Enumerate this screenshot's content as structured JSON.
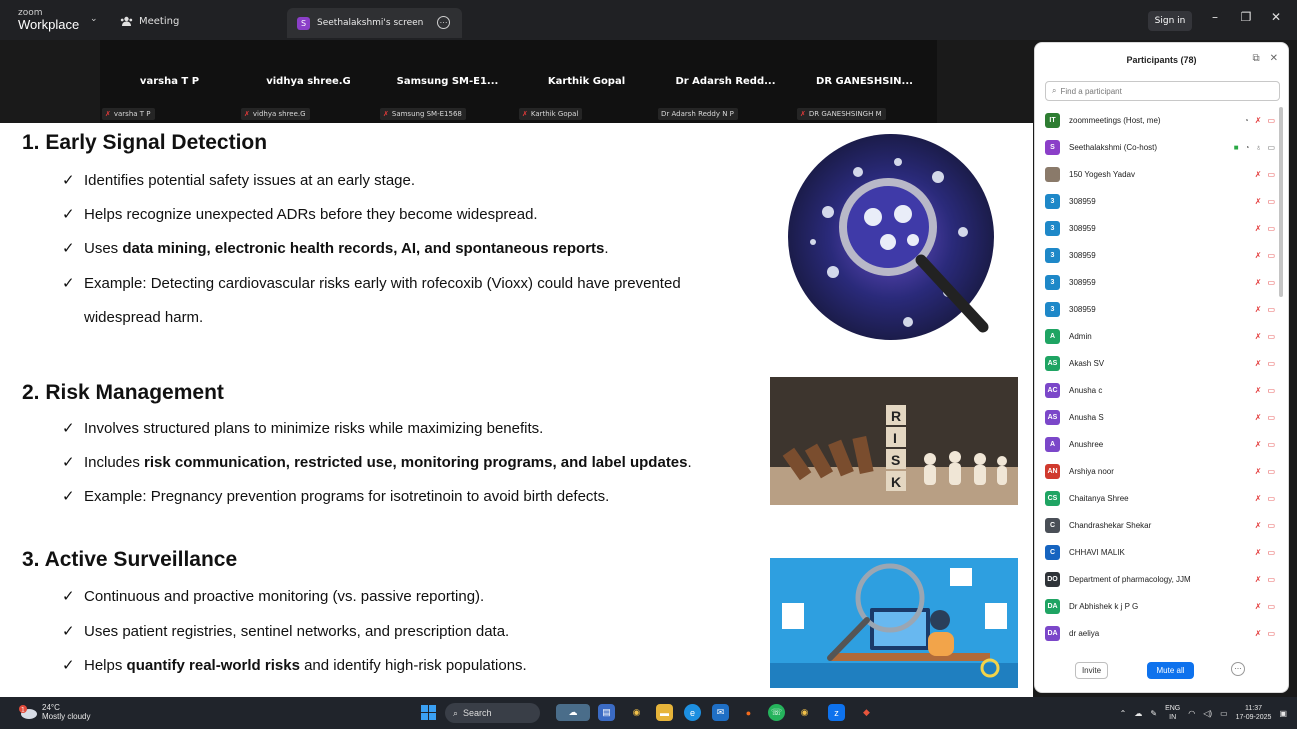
{
  "titlebar": {
    "logo_top": "zoom",
    "logo_bottom": "Workplace",
    "tab_meeting": "Meeting",
    "tab_screen": "Seethalakshmi's screen",
    "tab_screen_badge": "S",
    "sign_in": "Sign in",
    "icons": [
      "chevron-down-icon",
      "meeting-icon",
      "more-icon",
      "minimize-icon",
      "restore-icon",
      "close-icon"
    ]
  },
  "video_tiles": [
    {
      "name": "varsha T P",
      "label": "varsha T P",
      "muted": true
    },
    {
      "name": "vidhya shree.G",
      "label": "vidhya shree.G",
      "muted": true
    },
    {
      "name": "Samsung  SM-E1...",
      "label": "Samsung SM-E1568",
      "muted": true
    },
    {
      "name": "Karthik Gopal",
      "label": "Karthik Gopal",
      "muted": true
    },
    {
      "name": "Dr Adarsh Redd...",
      "label": "Dr Adarsh Reddy N P",
      "muted": false
    },
    {
      "name": "DR  GANESHSIN...",
      "label": "DR GANESHSINGH M",
      "muted": true
    }
  ],
  "slide": {
    "sections": [
      {
        "title": "1. Early Signal Detection",
        "bullets": [
          {
            "pre": "Identifies potential safety issues at an early stage.",
            "bold": "",
            "post": ""
          },
          {
            "pre": "Helps recognize unexpected ADRs before they become widespread.",
            "bold": "",
            "post": ""
          },
          {
            "pre": "Uses ",
            "bold": "data mining, electronic health records, AI, and spontaneous reports",
            "post": "."
          },
          {
            "pre": "Example: Detecting cardiovascular risks early with rofecoxib (Vioxx) could have prevented",
            "bold": "",
            "post": ""
          },
          {
            "pre": "widespread harm.",
            "bold": "",
            "post": ""
          }
        ]
      },
      {
        "title": "2. Risk Management",
        "bullets": [
          {
            "pre": "Involves structured plans to minimize risks while maximizing benefits.",
            "bold": "",
            "post": ""
          },
          {
            "pre": "Includes ",
            "bold": "risk communication, restricted use, monitoring programs, and label updates",
            "post": "."
          },
          {
            "pre": "Example: Pregnancy prevention programs for isotretinoin to avoid birth defects.",
            "bold": "",
            "post": ""
          }
        ]
      },
      {
        "title": "3. Active Surveillance",
        "bullets": [
          {
            "pre": "Continuous and proactive monitoring (vs. passive reporting).",
            "bold": "",
            "post": ""
          },
          {
            "pre": "Uses patient registries, sentinel networks, and prescription data.",
            "bold": "",
            "post": ""
          },
          {
            "pre": "Helps ",
            "bold": "quantify real-world risks",
            "post": " and identify high-risk populations."
          }
        ]
      }
    ],
    "risk_letters": [
      "R",
      "I",
      "S",
      "K"
    ]
  },
  "panel": {
    "title": "Participants (78)",
    "search_placeholder": "Find a participant",
    "invite": "Invite",
    "mute_all": "Mute all",
    "participants": [
      {
        "initials": "IT",
        "name": "zoommeetings (Host, me)",
        "color": "#2e7d32",
        "status": "host"
      },
      {
        "initials": "S",
        "name": "Seethalakshmi (Co-host)",
        "color": "#8b3fc8",
        "status": "cohost"
      },
      {
        "initials": "",
        "name": "150 Yogesh Yadav",
        "color": "#8a7a6a",
        "status": "muted"
      },
      {
        "initials": "3",
        "name": "308959",
        "color": "#1e88c8",
        "status": "muted"
      },
      {
        "initials": "3",
        "name": "308959",
        "color": "#1e88c8",
        "status": "muted"
      },
      {
        "initials": "3",
        "name": "308959",
        "color": "#1e88c8",
        "status": "muted"
      },
      {
        "initials": "3",
        "name": "308959",
        "color": "#1e88c8",
        "status": "muted"
      },
      {
        "initials": "3",
        "name": "308959",
        "color": "#1e88c8",
        "status": "muted"
      },
      {
        "initials": "A",
        "name": "Admin",
        "color": "#1fa463",
        "status": "muted"
      },
      {
        "initials": "AS",
        "name": "Akash SV",
        "color": "#1fa463",
        "status": "muted"
      },
      {
        "initials": "AC",
        "name": "Anusha c",
        "color": "#7b47c9",
        "status": "muted"
      },
      {
        "initials": "AS",
        "name": "Anusha S",
        "color": "#7b47c9",
        "status": "muted"
      },
      {
        "initials": "A",
        "name": "Anushree",
        "color": "#7b47c9",
        "status": "muted"
      },
      {
        "initials": "AN",
        "name": "Arshiya noor",
        "color": "#d03a2e",
        "status": "muted"
      },
      {
        "initials": "CS",
        "name": "Chaitanya Shree",
        "color": "#1fa463",
        "status": "muted"
      },
      {
        "initials": "C",
        "name": "Chandrashekar Shekar",
        "color": "#4a4f57",
        "status": "muted"
      },
      {
        "initials": "C",
        "name": "CHHAVI MALIK",
        "color": "#1664c0",
        "status": "muted"
      },
      {
        "initials": "DO",
        "name": "Department of pharmacology, JJM",
        "color": "#2f3338",
        "status": "muted"
      },
      {
        "initials": "DA",
        "name": "Dr Abhishek k j   P G",
        "color": "#1fa463",
        "status": "muted"
      },
      {
        "initials": "DA",
        "name": "dr aeliya",
        "color": "#7b47c9",
        "status": "muted"
      }
    ]
  },
  "taskbar": {
    "weather_temp": "24°C",
    "weather_desc": "Mostly cloudy",
    "weather_badge": "1",
    "search": "Search",
    "lang_top": "ENG",
    "lang_bottom": "IN",
    "time": "11:37",
    "date": "17-09-2025"
  }
}
